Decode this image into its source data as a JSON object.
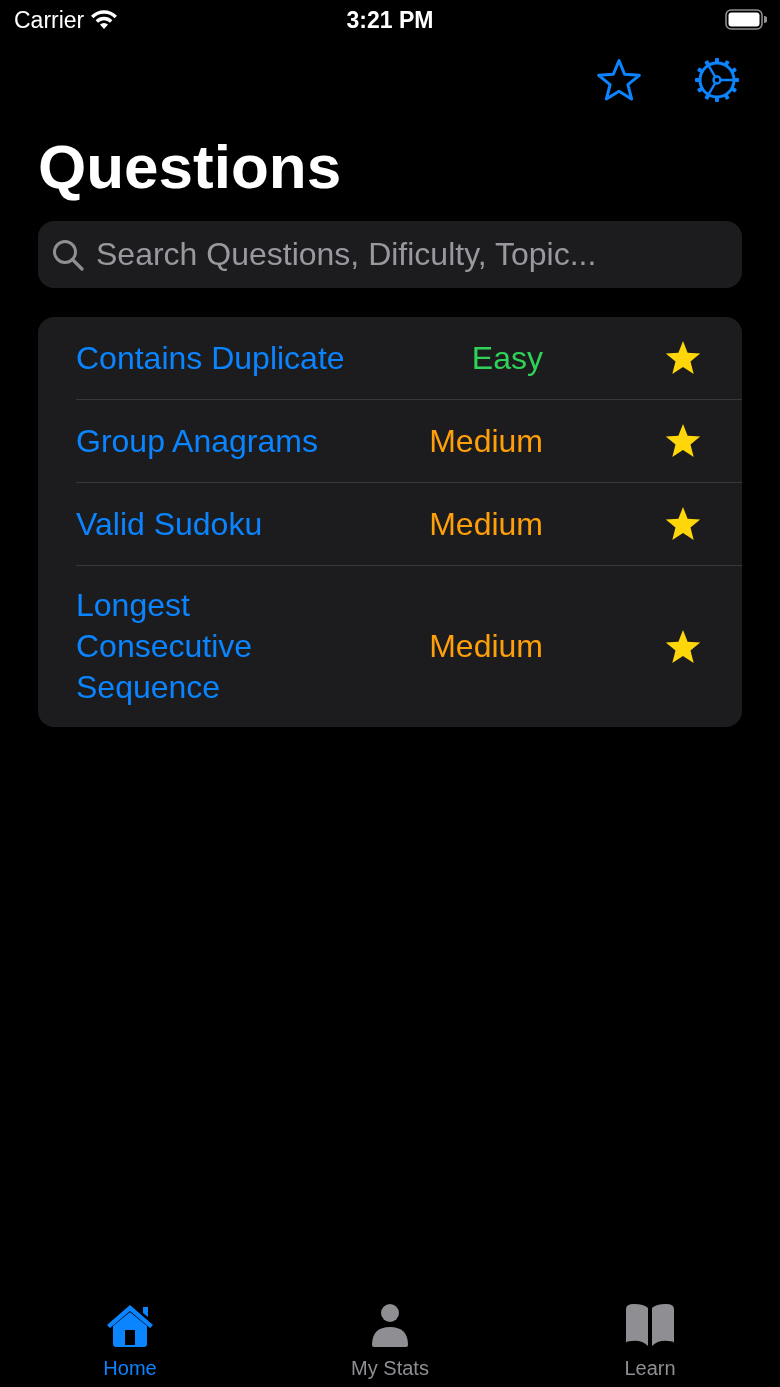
{
  "status_bar": {
    "carrier": "Carrier",
    "time": "3:21 PM"
  },
  "nav_bar": {
    "title": "Questions"
  },
  "search": {
    "placeholder": "Search Questions, Dificulty, Topic..."
  },
  "questions": [
    {
      "title": "Contains Duplicate",
      "difficulty": "Easy",
      "color": "#30d158",
      "favorite": true
    },
    {
      "title": "Group Anagrams",
      "difficulty": "Medium",
      "color": "#ff9f0a",
      "favorite": true
    },
    {
      "title": "Valid Sudoku",
      "difficulty": "Medium",
      "color": "#ff9f0a",
      "favorite": true
    },
    {
      "title": "Longest Consecutive Sequence",
      "difficulty": "Medium",
      "color": "#ff9f0a",
      "favorite": true
    }
  ],
  "tabs": [
    {
      "label": "Home",
      "kind": "home",
      "selected": true
    },
    {
      "label": "My Stats",
      "kind": "person",
      "selected": false
    },
    {
      "label": "Learn",
      "kind": "book",
      "selected": false
    }
  ]
}
